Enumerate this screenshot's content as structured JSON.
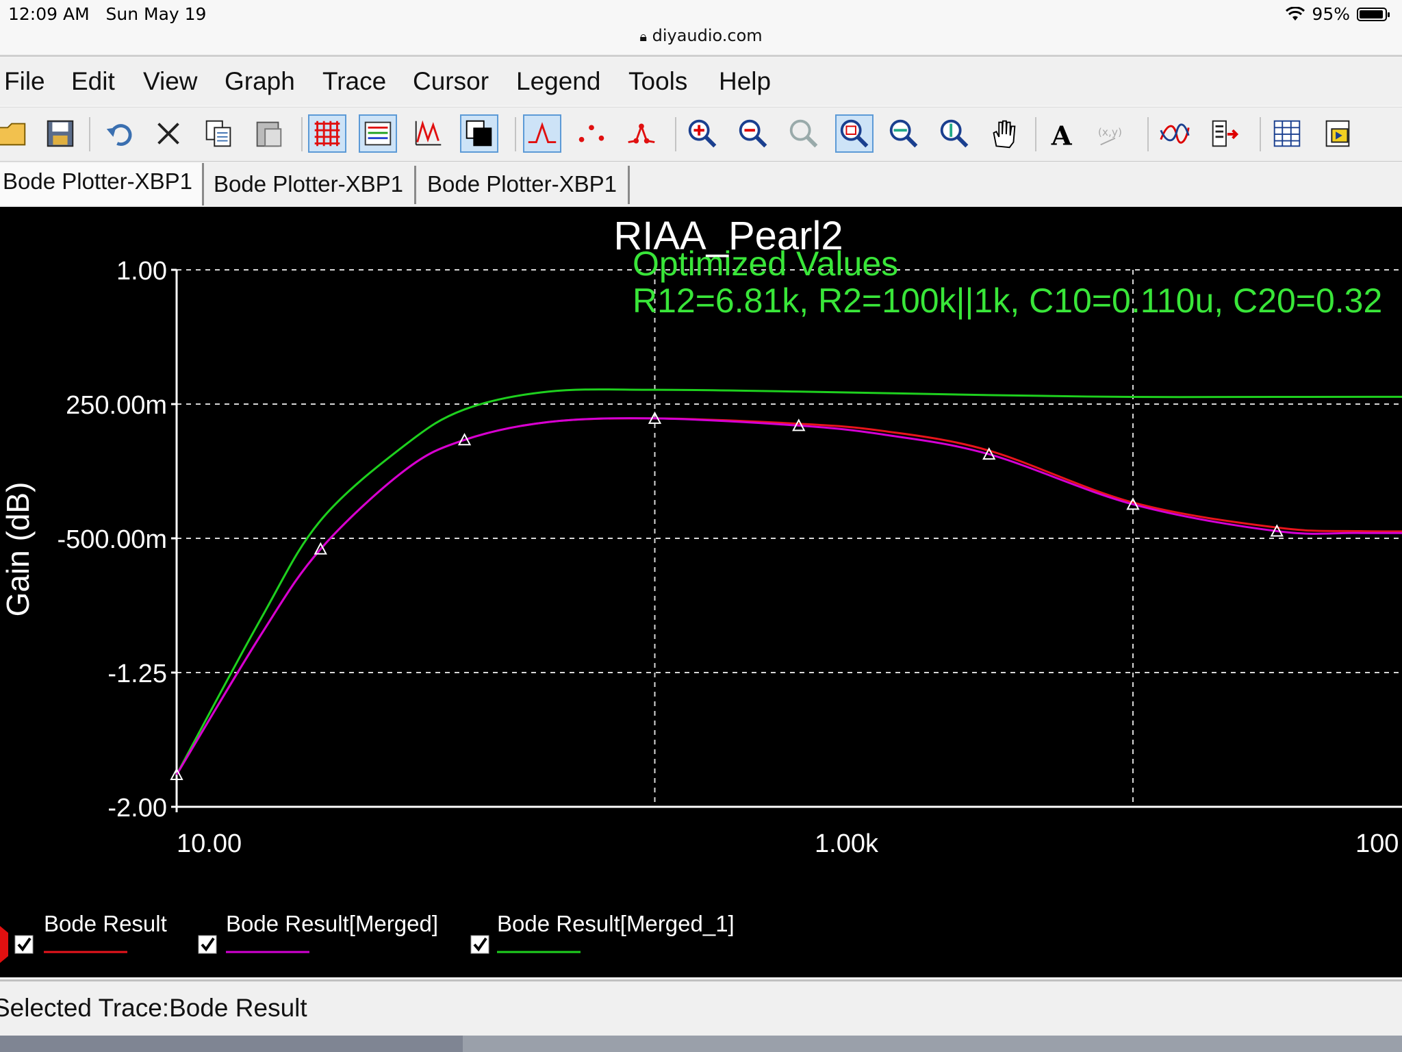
{
  "status_bar": {
    "time": "12:09 AM",
    "date": "Sun May 19",
    "battery": "95%",
    "url": "diyaudio.com"
  },
  "menu": [
    "File",
    "Edit",
    "View",
    "Graph",
    "Trace",
    "Cursor",
    "Legend",
    "Tools",
    "Help"
  ],
  "toolbar": [
    {
      "name": "open-icon",
      "active": false
    },
    {
      "name": "save-icon",
      "active": false
    },
    {
      "name": "undo-icon",
      "active": false
    },
    {
      "name": "delete-icon",
      "active": false
    },
    {
      "name": "copy-icon",
      "active": false
    },
    {
      "name": "paste-icon",
      "active": false
    },
    {
      "name": "grid-icon",
      "active": true
    },
    {
      "name": "legend-icon",
      "active": true
    },
    {
      "name": "ticks-icon",
      "active": false
    },
    {
      "name": "reverse-colors-icon",
      "active": true
    },
    {
      "name": "show-lines-icon",
      "active": true
    },
    {
      "name": "show-markers-icon",
      "active": false
    },
    {
      "name": "show-lines-markers-icon",
      "active": false
    },
    {
      "name": "zoom-in-icon",
      "active": false
    },
    {
      "name": "zoom-out-icon",
      "active": false
    },
    {
      "name": "zoom-full-icon",
      "active": false
    },
    {
      "name": "zoom-area-icon",
      "active": true
    },
    {
      "name": "zoom-x-icon",
      "active": false
    },
    {
      "name": "zoom-y-icon",
      "active": false
    },
    {
      "name": "pan-icon",
      "active": false
    },
    {
      "name": "text-icon",
      "active": false
    },
    {
      "name": "xy-label-icon",
      "active": false
    },
    {
      "name": "overlay-traces-icon",
      "active": false
    },
    {
      "name": "export-icon",
      "active": false
    },
    {
      "name": "export-excel-icon",
      "active": false
    },
    {
      "name": "export-labview-icon",
      "active": false
    }
  ],
  "tabs": [
    "Bode Plotter-XBP1",
    "Bode Plotter-XBP1",
    "Bode Plotter-XBP1"
  ],
  "plot": {
    "title": "RIAA_Pearl2",
    "annotation_line1": "Optimized Values",
    "annotation_line2": "R12=6.81k, R2=100k||1k, C10=0.110u, C20=0.32",
    "ylabel": "Gain (dB)",
    "ytick_labels": [
      "1.00",
      "250.00m",
      "-500.00m",
      "-1.25",
      "-2.00"
    ],
    "xtick_labels": [
      "10.00",
      "1.00k",
      "100"
    ],
    "legend": [
      {
        "label": "Bode Result",
        "color": "#e8141c"
      },
      {
        "label": "Bode Result[Merged]",
        "color": "#d400d4"
      },
      {
        "label": "Bode Result[Merged_1]",
        "color": "#1ed01e"
      }
    ]
  },
  "status_text": "Selected Trace:Bode Result",
  "chart_data": {
    "type": "line",
    "title": "RIAA_Pearl2",
    "xlabel": "",
    "ylabel": "Gain (dB)",
    "xscale": "log",
    "xlim": [
      10,
      100000
    ],
    "ylim": [
      -2.0,
      1.0
    ],
    "grid": true,
    "legend_position": "bottom",
    "series": [
      {
        "name": "Bode Result",
        "color": "#e8141c",
        "x": [
          10,
          15,
          20,
          30,
          40,
          60,
          100,
          200,
          300,
          500,
          1000,
          2000,
          3000,
          5000,
          10000,
          20000,
          30000,
          50000
        ],
        "y": [
          -1.82,
          -1.04,
          -0.56,
          -0.12,
          0.05,
          0.15,
          0.17,
          0.14,
          0.1,
          -0.01,
          -0.3,
          -0.44,
          -0.46,
          -0.46,
          -0.46,
          -0.47,
          -0.5,
          -0.61
        ]
      },
      {
        "name": "Bode Result[Merged]",
        "color": "#d400d4",
        "x": [
          10,
          15,
          20,
          30,
          40,
          60,
          100,
          200,
          300,
          500,
          1000,
          2000,
          3000,
          5000,
          10000,
          20000,
          30000,
          50000,
          60000
        ],
        "y": [
          -1.82,
          -1.04,
          -0.56,
          -0.12,
          0.05,
          0.15,
          0.17,
          0.13,
          0.08,
          -0.03,
          -0.31,
          -0.46,
          -0.47,
          -0.47,
          -0.47,
          -0.48,
          -0.52,
          -0.68,
          -0.86
        ]
      },
      {
        "name": "Bode Result[Merged_1]",
        "color": "#1ed01e",
        "x": [
          10,
          15,
          20,
          30,
          40,
          60,
          100,
          200,
          500,
          1000,
          2000,
          5000,
          10000,
          20000,
          30000,
          50000,
          60000
        ],
        "y": [
          -1.82,
          -0.95,
          -0.4,
          0.02,
          0.22,
          0.32,
          0.33,
          0.32,
          0.3,
          0.29,
          0.29,
          0.29,
          0.28,
          0.26,
          0.22,
          0.1,
          0.0
        ]
      }
    ]
  }
}
